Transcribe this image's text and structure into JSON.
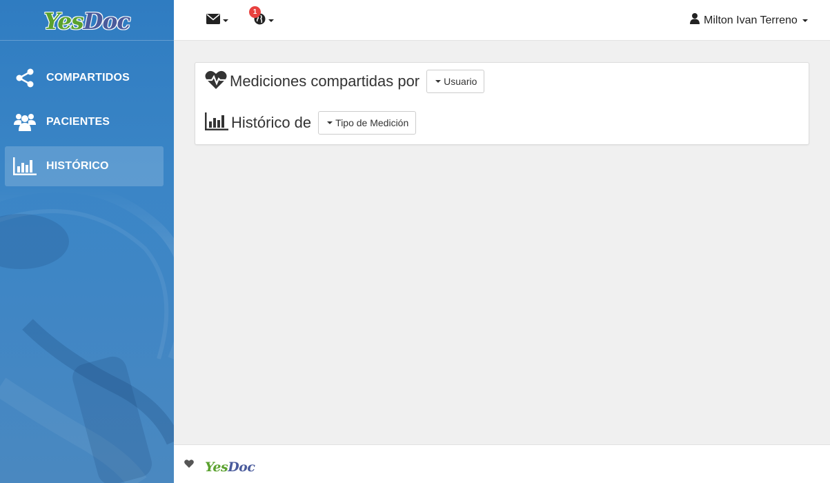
{
  "brand": {
    "logo_part1": "Yes",
    "logo_part2": "Doc",
    "colors": {
      "yes": "#5aa12e",
      "doc": "#4a5b9c"
    }
  },
  "sidebar": {
    "items": [
      {
        "label": "COMPARTIDOS",
        "icon": "share-icon",
        "active": false
      },
      {
        "label": "PACIENTES",
        "icon": "users-icon",
        "active": false
      },
      {
        "label": "HISTÓRICO",
        "icon": "bar-chart-icon",
        "active": true
      }
    ],
    "accent": "#2f7cc1"
  },
  "topbar": {
    "mail_icon": "envelope-icon",
    "globe_icon": "globe-icon",
    "notification_count": "1",
    "user_icon": "user-icon",
    "user_name": "Milton Ivan Terreno"
  },
  "panel": {
    "row1": {
      "icon": "heartbeat-icon",
      "title": "Mediciones compartidas por",
      "dropdown_label": "Usuario"
    },
    "row2": {
      "icon": "bar-chart-icon",
      "title": "Histórico de",
      "dropdown_label": "Tipo de Medición"
    }
  },
  "footer": {
    "icon": "heart-icon",
    "logo_part1": "Yes",
    "logo_part2": "Doc"
  }
}
